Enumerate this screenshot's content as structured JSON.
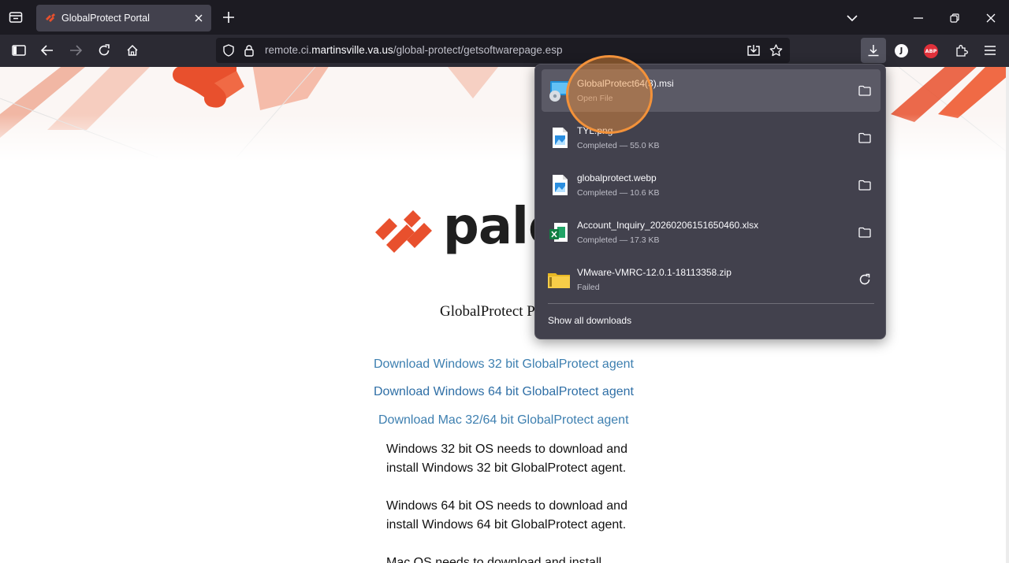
{
  "browser": {
    "tab": {
      "title": "GlobalProtect Portal"
    },
    "url": {
      "prefix": "remote.ci.",
      "host": "martinsville.va.us",
      "path": "/global-protect/getsoftwarepage.esp"
    },
    "extensions": {
      "j_label": "J",
      "abp_label": "ABP"
    }
  },
  "page": {
    "logo_text": "palo",
    "heading": "GlobalProtect P",
    "links": [
      "Download Windows 32 bit GlobalProtect agent",
      "Download Windows 64 bit GlobalProtect agent",
      "Download Mac 32/64 bit GlobalProtect agent"
    ],
    "notes": [
      "Windows 32 bit OS needs to download and install Windows 32 bit GlobalProtect agent.",
      "Windows 64 bit OS needs to download and install Windows 64 bit GlobalProtect agent.",
      "Mac OS needs to download and install"
    ]
  },
  "downloads": {
    "items": [
      {
        "name": "GlobalProtect64(3).msi",
        "status": "Open File",
        "icon": "installer-icon",
        "action": "folder-icon"
      },
      {
        "name": "TYL.png",
        "status": "Completed — 55.0 KB",
        "icon": "image-file-icon",
        "action": "folder-icon"
      },
      {
        "name": "globalprotect.webp",
        "status": "Completed — 10.6 KB",
        "icon": "image-file-icon",
        "action": "folder-icon"
      },
      {
        "name": "Account_Inquiry_20260206151650460.xlsx",
        "status": "Completed — 17.3 KB",
        "icon": "excel-file-icon",
        "action": "folder-icon"
      },
      {
        "name": "VMware-VMRC-12.0.1-18113358.zip",
        "status": "Failed",
        "icon": "zip-folder-icon",
        "action": "retry-icon"
      }
    ],
    "show_all": "Show all downloads"
  },
  "colors": {
    "accent": "#f3923a",
    "link": "#3d7fb0",
    "brand": "#e8502d"
  }
}
